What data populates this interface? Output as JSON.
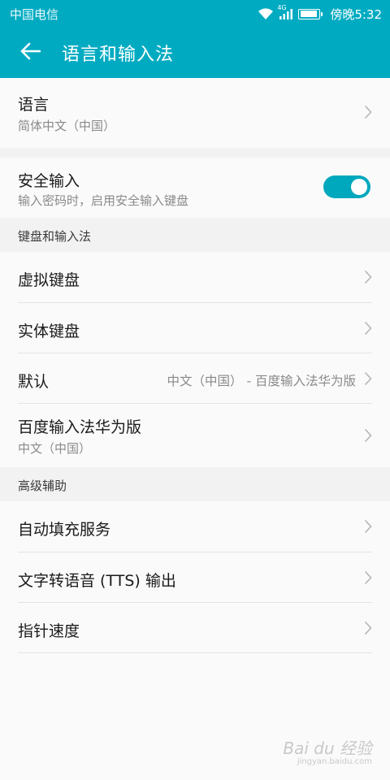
{
  "status_bar": {
    "carrier": "中国电信",
    "network": "4G",
    "time": "傍晚5:32"
  },
  "app_bar": {
    "title": "语言和输入法"
  },
  "language": {
    "title": "语言",
    "subtitle": "简体中文（中国）"
  },
  "secure_input": {
    "title": "安全输入",
    "subtitle": "输入密码时，启用安全输入键盘",
    "enabled": true
  },
  "keyboard_section": {
    "header": "键盘和输入法",
    "items": [
      {
        "title": "虚拟键盘"
      },
      {
        "title": "实体键盘"
      },
      {
        "title": "默认",
        "value": "中文（中国） - 百度输入法华为版"
      },
      {
        "title": "百度输入法华为版",
        "subtitle": "中文（中国）"
      }
    ]
  },
  "advanced_section": {
    "header": "高级辅助",
    "items": [
      {
        "title": "自动填充服务"
      },
      {
        "title": "文字转语音 (TTS) 输出"
      },
      {
        "title": "指针速度"
      }
    ]
  },
  "watermark": {
    "logo_text": "Bai du 经验",
    "url": "jingyan.baidu.com"
  },
  "colors": {
    "accent": "#00abc2",
    "toggle_on": "#00a8bd",
    "background": "#f7f7f7"
  }
}
